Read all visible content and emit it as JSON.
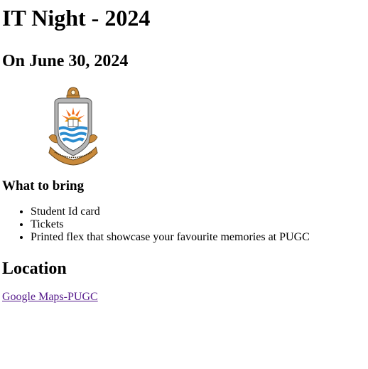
{
  "header": {
    "title": "IT Night - 2024",
    "date": "On June 30, 2024"
  },
  "logo": {
    "icon": "university-crest-icon",
    "colors": {
      "gold": "#c8893a",
      "blue": "#2a8ccf",
      "sun": "#f26c1c",
      "grey": "#9a9a9a"
    }
  },
  "bring": {
    "heading": "What to bring",
    "items": [
      "Student Id card",
      "Tickets",
      "Printed flex that showcase your favourite memories at PUGC"
    ]
  },
  "location": {
    "heading": "Location",
    "link_text": "Google Maps-PUGC",
    "link_color": "#551a8b"
  }
}
